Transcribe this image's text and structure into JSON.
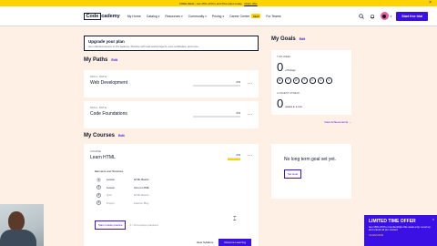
{
  "promo": {
    "text": "FREE DEAL: Get 15% off Pro and Plus plans today.",
    "link": "Claim offer",
    "close": "×"
  },
  "nav": {
    "logo_box": "Code",
    "logo_rest": "cademy",
    "links": [
      {
        "label": "My Home",
        "caret": ""
      },
      {
        "label": "Catalog",
        "caret": "▾"
      },
      {
        "label": "Resources",
        "caret": "▾"
      },
      {
        "label": "Community",
        "caret": "▾"
      },
      {
        "label": "Pricing",
        "caret": "▾"
      },
      {
        "label": "Career Center",
        "caret": ""
      },
      {
        "label": "For Teams",
        "caret": ""
      }
    ],
    "career_badge": "NEW",
    "cta": "Start free trial"
  },
  "upgrade": {
    "title": "Upgrade your plan",
    "text": "Get unlimited access to Pro features. Practice with real-world projects, earn certificates, and more."
  },
  "paths": {
    "title": "My Paths",
    "edit": "Edit",
    "items": [
      {
        "label": "SKILL PATH",
        "name": "Web Development",
        "pct": "0%",
        "progress": 0.0
      },
      {
        "label": "SKILL PATH",
        "name": "Code Foundations",
        "pct": "0%",
        "progress": 0.0
      }
    ]
  },
  "courses": {
    "title": "My Courses",
    "edit": "Edit",
    "course": {
      "type": "COURSE",
      "name": "Learn HTML",
      "pct": "0%",
      "progress": 1.0,
      "lessons_title": "Elements and Structure",
      "lessons": [
        {
          "n": "1",
          "kind": "Lesson",
          "name": "HTML Basics"
        },
        {
          "n": "2",
          "kind": "Lesson",
          "name": "Intro to HTML"
        },
        {
          "n": "3",
          "kind": "Quiz",
          "name": "HTML Basics"
        },
        {
          "n": "4",
          "kind": "Project",
          "name": "Fashion Blog"
        }
      ],
      "practice_button": "Start module practice",
      "practice_note": "0 / 10 concepts practiced",
      "syllabus_link": "View Syllabus",
      "resume_button": "Resume Learning"
    }
  },
  "goals": {
    "title": "My Goals",
    "edit": "Edit",
    "week_label": "THIS WEEK",
    "week_value": "0",
    "week_unit": "of 5 days",
    "days": [
      "M",
      "T",
      "W",
      "T",
      "F",
      "S",
      "S"
    ],
    "streak_label": "LONGEST STREAK",
    "streak_value": "0",
    "streak_unit": "weeks in a row",
    "achievements_link": "View Achievements →",
    "long_term_text": "No long term goal set yet.",
    "set_goal_button": "Set Goal"
  },
  "offer": {
    "title": "LIMITED TIME OFFER",
    "text": "Get 15% off Pro memberships this week only. Level up and unlock all pro content.",
    "code": "CLAIM NOW",
    "close": "×"
  },
  "colors": {
    "accent": "#3a10e5",
    "background": "#fff0e5",
    "highlight": "#ffd300",
    "navy": "#10162f"
  }
}
